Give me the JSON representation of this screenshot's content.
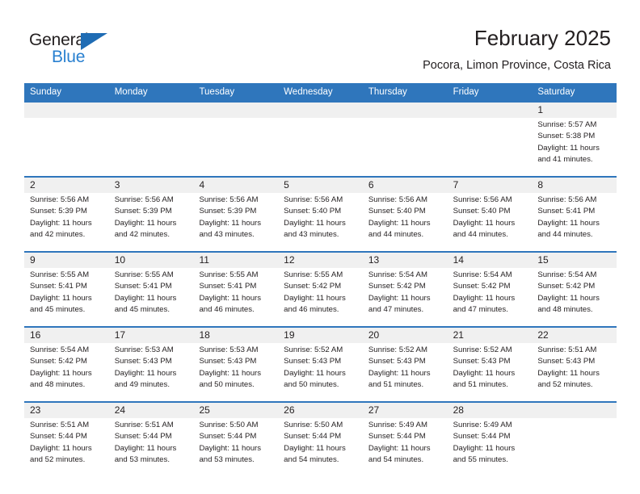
{
  "brand": {
    "name_part1": "General",
    "name_part2": "Blue",
    "accent_color": "#2980d0",
    "triangle_color": "#1f6cb4"
  },
  "header": {
    "title": "February 2025",
    "subtitle": "Pocora, Limon Province, Costa Rica"
  },
  "calendar": {
    "header_bg_color": "#2f76bc",
    "row_band_color": "#f0f0f0",
    "weekdays": [
      "Sunday",
      "Monday",
      "Tuesday",
      "Wednesday",
      "Thursday",
      "Friday",
      "Saturday"
    ],
    "weeks": [
      [
        {
          "day": "",
          "sunrise": "",
          "sunset": "",
          "daylight": "",
          "empty": true
        },
        {
          "day": "",
          "sunrise": "",
          "sunset": "",
          "daylight": "",
          "empty": true
        },
        {
          "day": "",
          "sunrise": "",
          "sunset": "",
          "daylight": "",
          "empty": true
        },
        {
          "day": "",
          "sunrise": "",
          "sunset": "",
          "daylight": "",
          "empty": true
        },
        {
          "day": "",
          "sunrise": "",
          "sunset": "",
          "daylight": "",
          "empty": true
        },
        {
          "day": "",
          "sunrise": "",
          "sunset": "",
          "daylight": "",
          "empty": true
        },
        {
          "day": "1",
          "sunrise": "Sunrise: 5:57 AM",
          "sunset": "Sunset: 5:38 PM",
          "daylight": "Daylight: 11 hours and 41 minutes."
        }
      ],
      [
        {
          "day": "2",
          "sunrise": "Sunrise: 5:56 AM",
          "sunset": "Sunset: 5:39 PM",
          "daylight": "Daylight: 11 hours and 42 minutes."
        },
        {
          "day": "3",
          "sunrise": "Sunrise: 5:56 AM",
          "sunset": "Sunset: 5:39 PM",
          "daylight": "Daylight: 11 hours and 42 minutes."
        },
        {
          "day": "4",
          "sunrise": "Sunrise: 5:56 AM",
          "sunset": "Sunset: 5:39 PM",
          "daylight": "Daylight: 11 hours and 43 minutes."
        },
        {
          "day": "5",
          "sunrise": "Sunrise: 5:56 AM",
          "sunset": "Sunset: 5:40 PM",
          "daylight": "Daylight: 11 hours and 43 minutes."
        },
        {
          "day": "6",
          "sunrise": "Sunrise: 5:56 AM",
          "sunset": "Sunset: 5:40 PM",
          "daylight": "Daylight: 11 hours and 44 minutes."
        },
        {
          "day": "7",
          "sunrise": "Sunrise: 5:56 AM",
          "sunset": "Sunset: 5:40 PM",
          "daylight": "Daylight: 11 hours and 44 minutes."
        },
        {
          "day": "8",
          "sunrise": "Sunrise: 5:56 AM",
          "sunset": "Sunset: 5:41 PM",
          "daylight": "Daylight: 11 hours and 44 minutes."
        }
      ],
      [
        {
          "day": "9",
          "sunrise": "Sunrise: 5:55 AM",
          "sunset": "Sunset: 5:41 PM",
          "daylight": "Daylight: 11 hours and 45 minutes."
        },
        {
          "day": "10",
          "sunrise": "Sunrise: 5:55 AM",
          "sunset": "Sunset: 5:41 PM",
          "daylight": "Daylight: 11 hours and 45 minutes."
        },
        {
          "day": "11",
          "sunrise": "Sunrise: 5:55 AM",
          "sunset": "Sunset: 5:41 PM",
          "daylight": "Daylight: 11 hours and 46 minutes."
        },
        {
          "day": "12",
          "sunrise": "Sunrise: 5:55 AM",
          "sunset": "Sunset: 5:42 PM",
          "daylight": "Daylight: 11 hours and 46 minutes."
        },
        {
          "day": "13",
          "sunrise": "Sunrise: 5:54 AM",
          "sunset": "Sunset: 5:42 PM",
          "daylight": "Daylight: 11 hours and 47 minutes."
        },
        {
          "day": "14",
          "sunrise": "Sunrise: 5:54 AM",
          "sunset": "Sunset: 5:42 PM",
          "daylight": "Daylight: 11 hours and 47 minutes."
        },
        {
          "day": "15",
          "sunrise": "Sunrise: 5:54 AM",
          "sunset": "Sunset: 5:42 PM",
          "daylight": "Daylight: 11 hours and 48 minutes."
        }
      ],
      [
        {
          "day": "16",
          "sunrise": "Sunrise: 5:54 AM",
          "sunset": "Sunset: 5:42 PM",
          "daylight": "Daylight: 11 hours and 48 minutes."
        },
        {
          "day": "17",
          "sunrise": "Sunrise: 5:53 AM",
          "sunset": "Sunset: 5:43 PM",
          "daylight": "Daylight: 11 hours and 49 minutes."
        },
        {
          "day": "18",
          "sunrise": "Sunrise: 5:53 AM",
          "sunset": "Sunset: 5:43 PM",
          "daylight": "Daylight: 11 hours and 50 minutes."
        },
        {
          "day": "19",
          "sunrise": "Sunrise: 5:52 AM",
          "sunset": "Sunset: 5:43 PM",
          "daylight": "Daylight: 11 hours and 50 minutes."
        },
        {
          "day": "20",
          "sunrise": "Sunrise: 5:52 AM",
          "sunset": "Sunset: 5:43 PM",
          "daylight": "Daylight: 11 hours and 51 minutes."
        },
        {
          "day": "21",
          "sunrise": "Sunrise: 5:52 AM",
          "sunset": "Sunset: 5:43 PM",
          "daylight": "Daylight: 11 hours and 51 minutes."
        },
        {
          "day": "22",
          "sunrise": "Sunrise: 5:51 AM",
          "sunset": "Sunset: 5:43 PM",
          "daylight": "Daylight: 11 hours and 52 minutes."
        }
      ],
      [
        {
          "day": "23",
          "sunrise": "Sunrise: 5:51 AM",
          "sunset": "Sunset: 5:44 PM",
          "daylight": "Daylight: 11 hours and 52 minutes."
        },
        {
          "day": "24",
          "sunrise": "Sunrise: 5:51 AM",
          "sunset": "Sunset: 5:44 PM",
          "daylight": "Daylight: 11 hours and 53 minutes."
        },
        {
          "day": "25",
          "sunrise": "Sunrise: 5:50 AM",
          "sunset": "Sunset: 5:44 PM",
          "daylight": "Daylight: 11 hours and 53 minutes."
        },
        {
          "day": "26",
          "sunrise": "Sunrise: 5:50 AM",
          "sunset": "Sunset: 5:44 PM",
          "daylight": "Daylight: 11 hours and 54 minutes."
        },
        {
          "day": "27",
          "sunrise": "Sunrise: 5:49 AM",
          "sunset": "Sunset: 5:44 PM",
          "daylight": "Daylight: 11 hours and 54 minutes."
        },
        {
          "day": "28",
          "sunrise": "Sunrise: 5:49 AM",
          "sunset": "Sunset: 5:44 PM",
          "daylight": "Daylight: 11 hours and 55 minutes."
        },
        {
          "day": "",
          "sunrise": "",
          "sunset": "",
          "daylight": "",
          "empty": true
        }
      ]
    ]
  }
}
